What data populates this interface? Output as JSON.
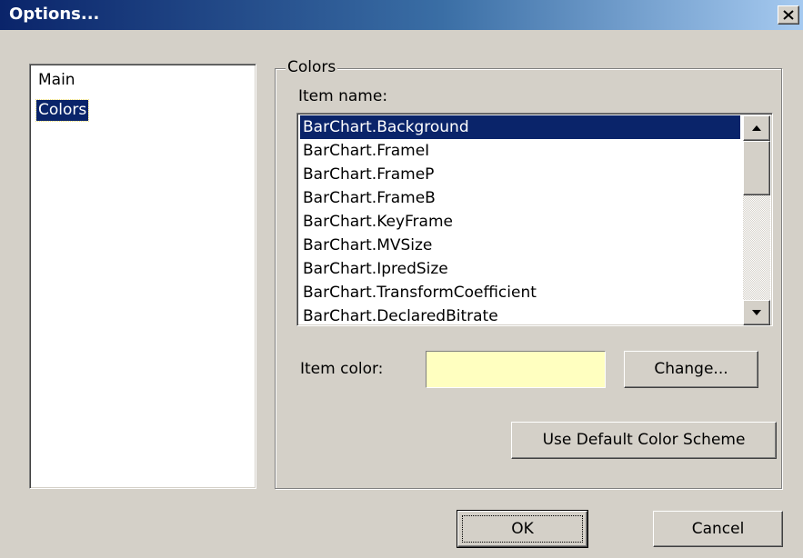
{
  "window": {
    "title": "Options...",
    "close_label": "close"
  },
  "categories": [
    "Main",
    "Colors"
  ],
  "selected_category": "Colors",
  "colors_group": {
    "legend": "Colors",
    "item_name_label": "Item name:",
    "items": [
      "BarChart.Background",
      "BarChart.FrameI",
      "BarChart.FrameP",
      "BarChart.FrameB",
      "BarChart.KeyFrame",
      "BarChart.MVSize",
      "BarChart.IpredSize",
      "BarChart.TransformCoefficient",
      "BarChart.DeclaredBitrate"
    ],
    "selected_item": "BarChart.Background",
    "item_color_label": "Item color:",
    "item_color": "#ffffc0",
    "change_button": "Change...",
    "default_scheme_button": "Use Default Color Scheme"
  },
  "footer": {
    "ok": "OK",
    "cancel": "Cancel"
  },
  "theme": {
    "selection_bg": "#0a246a",
    "face": "#d4d0c8"
  }
}
